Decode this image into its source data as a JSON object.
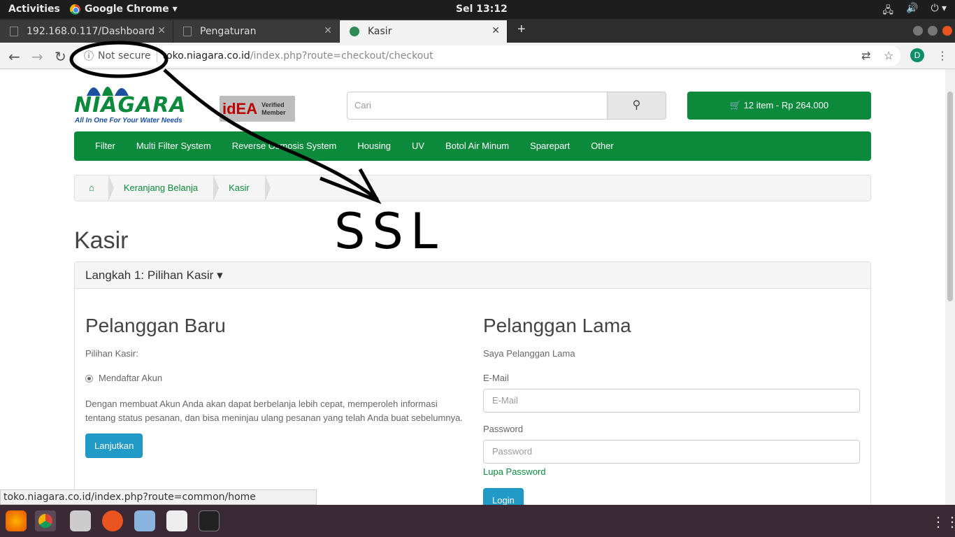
{
  "topbar": {
    "activities": "Activities",
    "app": "Google Chrome ▾",
    "clock": "Sel 13:12"
  },
  "tabs": [
    {
      "label": "192.168.0.117/Dashboard"
    },
    {
      "label": "Pengaturan"
    },
    {
      "label": "Kasir"
    }
  ],
  "omnibar": {
    "security": "Not secure",
    "host": "toko.niagara.co.id",
    "path": "/index.php?route=checkout/checkout",
    "avatar": "D"
  },
  "site": {
    "brand": "NIAGARA",
    "tagline": "All In One For Your Water Needs",
    "idea": "idEA",
    "idea_badge": "Verified Member",
    "search_placeholder": "Cari",
    "cart": "🛒 12 item - Rp 264.000",
    "menu": [
      "Filter",
      "Multi Filter System",
      "Reverse Osmosis System",
      "Housing",
      "UV",
      "Botol Air Minum",
      "Sparepart",
      "Other"
    ],
    "breadcrumb": [
      "Keranjang Belanja",
      "Kasir"
    ],
    "page_title": "Kasir",
    "step": "Langkah 1: Pilihan Kasir ▾",
    "new_customer": {
      "title": "Pelanggan Baru",
      "option_label": "Pilihan Kasir:",
      "radio": "Mendaftar Akun",
      "desc1": "Dengan membuat Akun Anda akan dapat berbelanja lebih cepat, memperoleh informasi",
      "desc2": "tentang status pesanan, dan bisa meninjau ulang pesanan yang telah Anda buat sebelumnya.",
      "button": "Lanjutkan"
    },
    "returning_customer": {
      "title": "Pelanggan Lama",
      "subtitle": "Saya Pelanggan Lama",
      "email_label": "E-Mail",
      "email_placeholder": "E-Mail",
      "password_label": "Password",
      "password_placeholder": "Password",
      "forgot": "Lupa Password",
      "button": "Login"
    }
  },
  "annotation": "SSL",
  "statusbar": "toko.niagara.co.id/index.php?route=common/home",
  "colors": {
    "brand_green": "#0c8a3c",
    "button_blue": "#229ac8"
  }
}
